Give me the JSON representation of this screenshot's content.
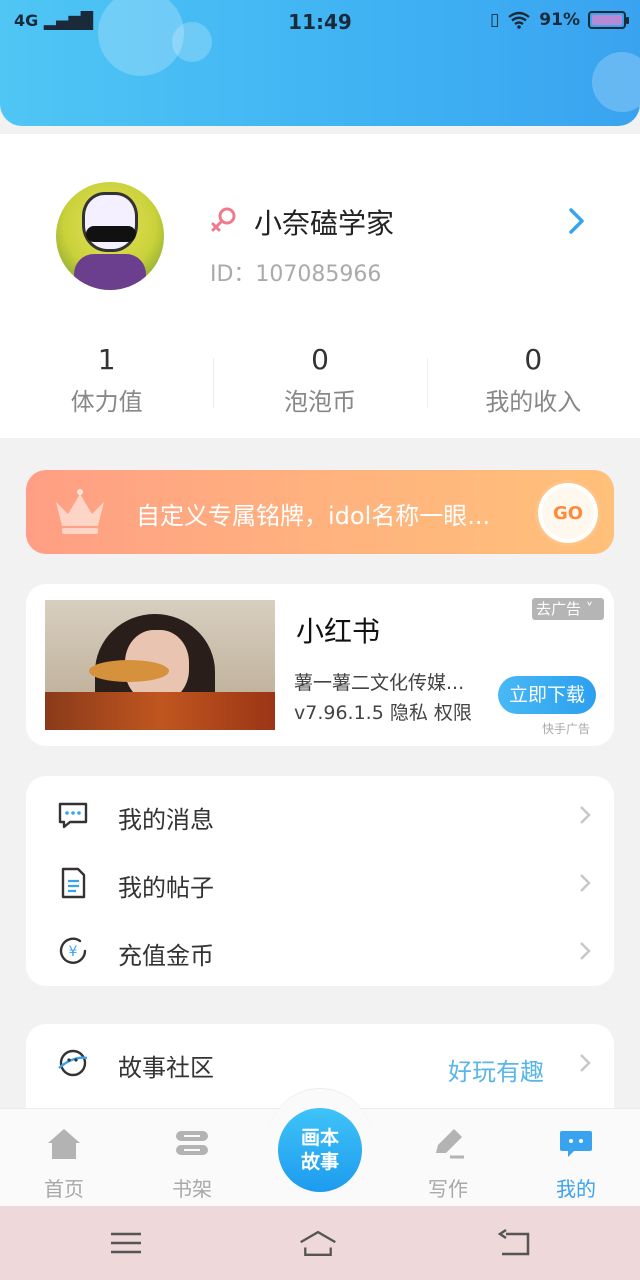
{
  "status_bar": {
    "network": "4G",
    "time": "11:49",
    "battery": "91%",
    "battery_level": 0.91
  },
  "profile": {
    "username": "小奈磕学家",
    "user_id": "ID：107085966",
    "stats": [
      {
        "value": "1",
        "label": "体力值"
      },
      {
        "value": "0",
        "label": "泡泡币"
      },
      {
        "value": "0",
        "label": "我的收入"
      }
    ]
  },
  "banner": {
    "text": "自定义专属铭牌，idol名称一眼...",
    "button": "GO"
  },
  "ad": {
    "title": "小红书",
    "close_label": "去广告",
    "company": "薯一薯二文化传媒...",
    "version": "v7.96.1.5  隐私  权限",
    "download_label": "立即下载",
    "source": "快手广告"
  },
  "menu": [
    {
      "label": "我的消息",
      "icon": "message-icon"
    },
    {
      "label": "我的帖子",
      "icon": "document-icon"
    },
    {
      "label": "充值金币",
      "icon": "coin-icon"
    }
  ],
  "menu2": {
    "label": "故事社区",
    "extra": "好玩有趣",
    "icon": "planet-icon"
  },
  "bottom_nav": {
    "items": [
      {
        "label": "首页",
        "icon": "home-icon"
      },
      {
        "label": "书架",
        "icon": "bookshelf-icon"
      },
      {
        "label": "写作",
        "icon": "pen-icon"
      },
      {
        "label": "我的",
        "icon": "chat-bubble-icon"
      }
    ],
    "center_label": "画本故事",
    "active": "我的"
  },
  "colors": {
    "accent": "#3aa3ef",
    "banner_start": "#ff9e84",
    "banner_end": "#ffc07a"
  }
}
